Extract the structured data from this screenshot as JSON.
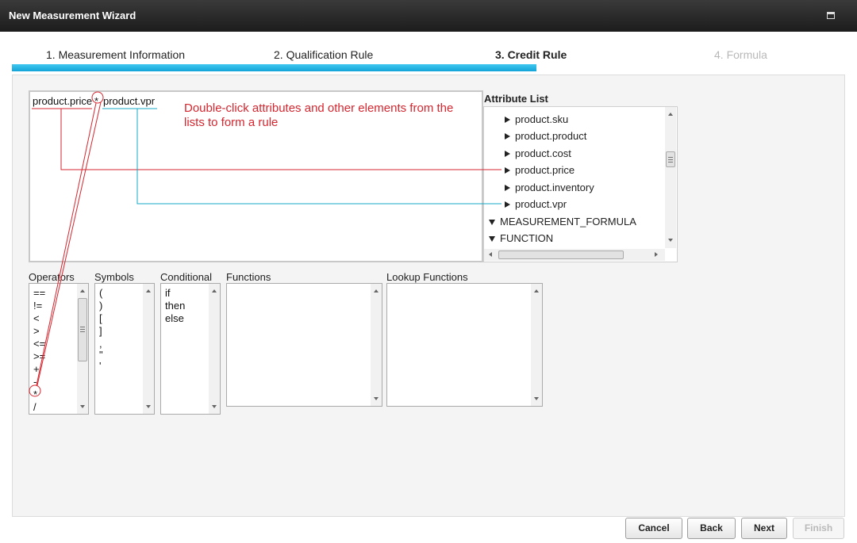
{
  "window": {
    "title": "New Measurement Wizard",
    "maximize_icon": "maximize-icon"
  },
  "steps": [
    {
      "label": "1. Measurement Information",
      "state": "done"
    },
    {
      "label": "2. Qualification Rule",
      "state": "done"
    },
    {
      "label": "3. Credit Rule",
      "state": "active"
    },
    {
      "label": "4. Formula",
      "state": "disabled"
    }
  ],
  "progress": {
    "completed_steps": 3,
    "total_steps": 4
  },
  "rule": {
    "tokens": [
      "product.price",
      "*",
      "product.vpr"
    ],
    "hint": "Double-click attributes and other elements from the lists to form a rule"
  },
  "attribute_list": {
    "label": "Attribute List",
    "items": [
      {
        "label": "product.sku",
        "kind": "leaf"
      },
      {
        "label": "product.product",
        "kind": "leaf"
      },
      {
        "label": "product.cost",
        "kind": "leaf"
      },
      {
        "label": "product.price",
        "kind": "leaf"
      },
      {
        "label": "product.inventory",
        "kind": "leaf"
      },
      {
        "label": "product.vpr",
        "kind": "leaf"
      },
      {
        "label": "MEASUREMENT_FORMULA",
        "kind": "group-expanded"
      },
      {
        "label": "FUNCTION",
        "kind": "group-expanded"
      }
    ]
  },
  "lists": {
    "operators": {
      "label": "Operators",
      "items": [
        "==",
        "!=",
        "<",
        ">",
        "<=",
        ">=",
        "+",
        "-",
        "*",
        "/"
      ]
    },
    "symbols": {
      "label": "Symbols",
      "items": [
        "(",
        ")",
        "[",
        "]",
        ",",
        "\"",
        "'"
      ]
    },
    "conditional": {
      "label": "Conditional",
      "items": [
        "if",
        "then",
        "else"
      ]
    },
    "functions": {
      "label": "Functions",
      "items": []
    },
    "lookup_functions": {
      "label": "Lookup Functions",
      "items": []
    }
  },
  "buttons": {
    "cancel": "Cancel",
    "back": "Back",
    "next": "Next",
    "finish": "Finish"
  },
  "colors": {
    "accent": "#14a4d8",
    "hint": "#d6262f",
    "annotation_red": "#d6262f",
    "annotation_cyan": "#17a9c9"
  }
}
